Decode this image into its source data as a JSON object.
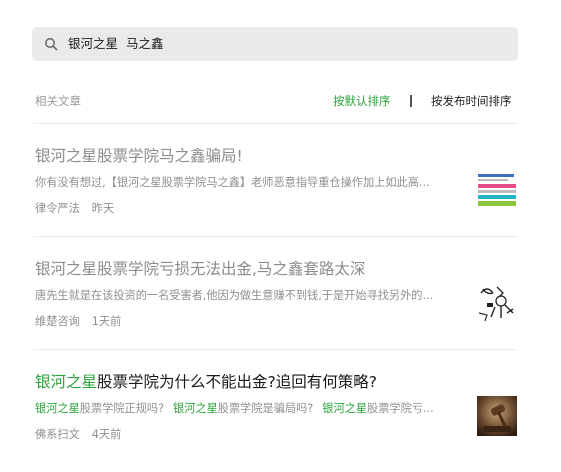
{
  "search": {
    "query": "银河之星  马之鑫"
  },
  "filter": {
    "label": "相关文章",
    "sort_default": "按默认排序",
    "sort_time": "按发布时间排序"
  },
  "articles": [
    {
      "title": "银河之星股票学院马之鑫骗局!",
      "summary": "你有没有想过,【银河之星股票学院马之鑫】老师恶意指导重仓操作加上如此高...",
      "source": "律令严法",
      "time": "昨天",
      "thumb": "banner-lines-image"
    },
    {
      "title": "银河之星股票学院亏损无法出金,马之鑫套路太深",
      "summary": "唐先生就是在该投资的一名受害者,他因为做生意赚不到钱,于是开始寻找另外的...",
      "source": "维楚咨询",
      "time": "1天前",
      "thumb": "cartoon-sketch-image"
    },
    {
      "title_hl": "银河之星",
      "title_rest": "股票学院为什么不能出金?追回有何策略?",
      "summary_parts": [
        {
          "hl": "银河之星",
          "text": "股票学院正规吗?"
        },
        {
          "hl": "银河之星",
          "text": "股票学院是骗局吗?"
        },
        {
          "hl": "银河之星",
          "text": "股票学院亏..."
        }
      ],
      "source": "佛系扫文",
      "time": "4天前",
      "thumb": "gavel-photo-image"
    }
  ],
  "colors": {
    "accent": "#2aa43b",
    "search_bg": "#eaeaea",
    "muted": "#8f8f8f"
  }
}
